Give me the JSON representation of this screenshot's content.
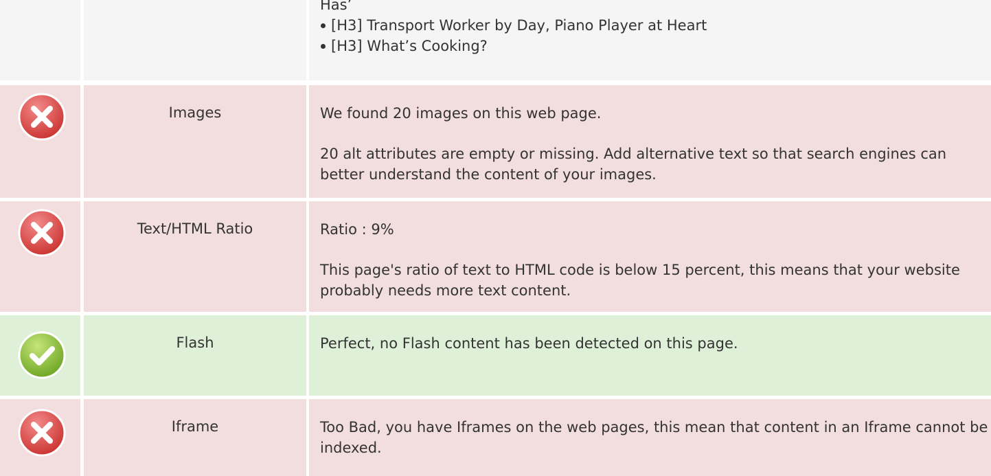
{
  "headings_row": {
    "fragment": "Has’",
    "items": [
      "[H3] Transport Worker by Day, Piano Player at Heart",
      "[H3] What’s Cooking?"
    ]
  },
  "checks": [
    {
      "status": "error",
      "icon": "error-x-icon",
      "label": "Images",
      "lines": [
        "We found 20 images on this web page.",
        "20 alt attributes are empty or missing. Add alternative text so that search engines can better understand the content of your images."
      ]
    },
    {
      "status": "error",
      "icon": "error-x-icon",
      "label": "Text/HTML Ratio",
      "lines": [
        "Ratio : 9%",
        "This page's ratio of text to HTML code is below 15 percent, this means that your website probably needs more text content."
      ]
    },
    {
      "status": "ok",
      "icon": "checkmark-icon",
      "label": "Flash",
      "lines": [
        "Perfect, no Flash content has been detected on this page."
      ]
    },
    {
      "status": "error",
      "icon": "error-x-icon",
      "label": "Iframe",
      "lines": [
        "Too Bad, you have Iframes on the web pages, this mean that content in an Iframe cannot be indexed."
      ]
    }
  ],
  "colors": {
    "error_bg": "#f2dede",
    "ok_bg": "#dff0d8",
    "neutral_bg": "#f5f5f5",
    "error_icon": "#d9534f",
    "ok_icon": "#8cc63e",
    "text": "#333333"
  }
}
